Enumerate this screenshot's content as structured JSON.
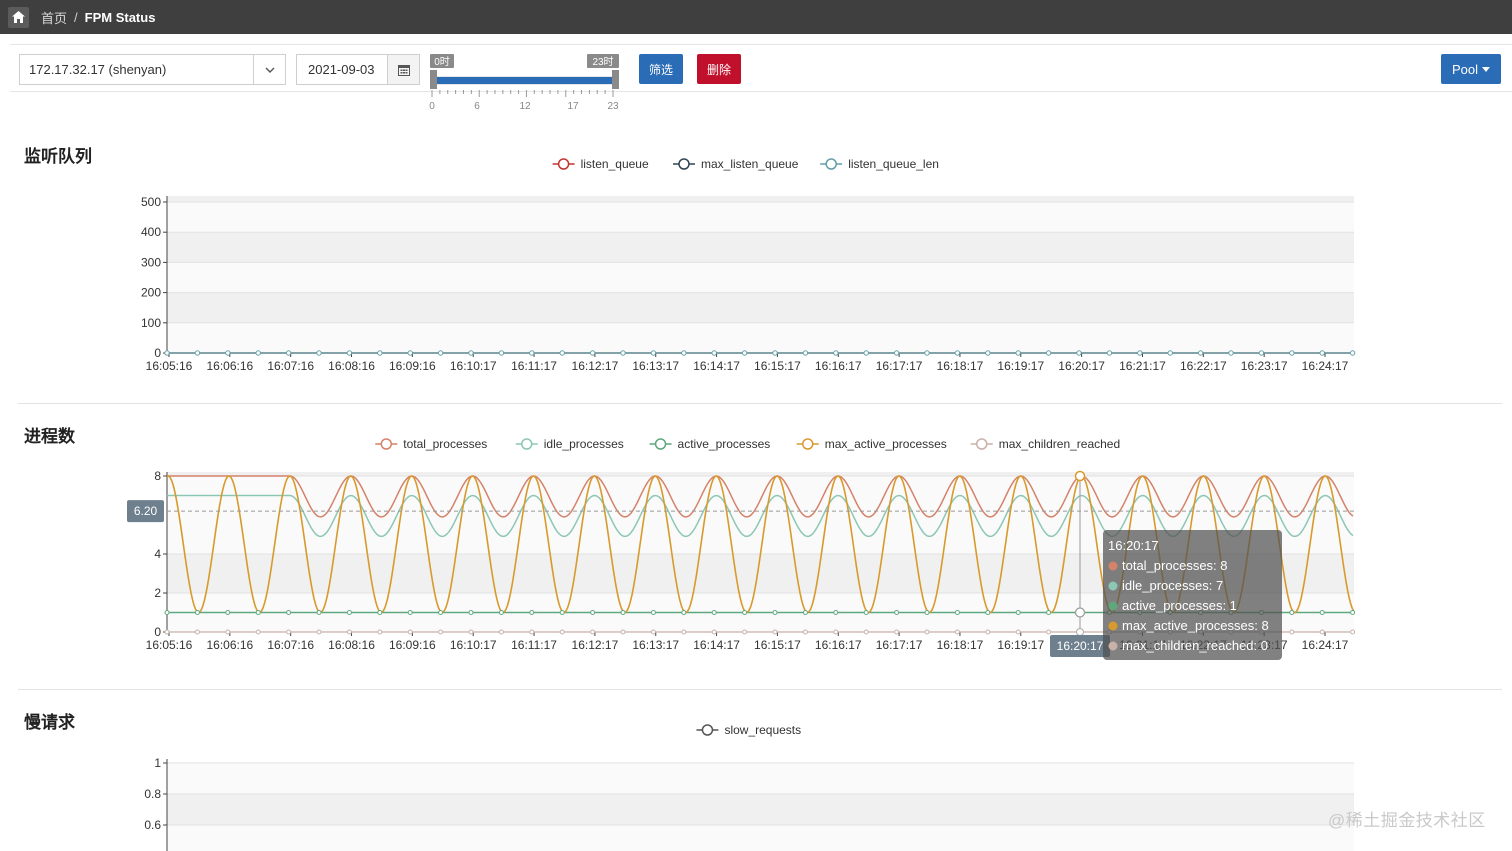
{
  "breadcrumb": {
    "home": "首页",
    "separator": "/",
    "current": "FPM Status"
  },
  "toolbar": {
    "server": "172.17.32.17 (shenyan)",
    "date": "2021-09-03",
    "range_start_label": "0时",
    "range_end_label": "23时",
    "range_ticks": [
      "0",
      "6",
      "12",
      "17",
      "23"
    ],
    "filter_label": "筛选",
    "delete_label": "删除",
    "pool_label": "Pool"
  },
  "sections": {
    "listen": "监听队列",
    "processes": "进程数",
    "slow": "慢请求"
  },
  "watermark": "@稀土掘金技术社区",
  "chart_data": [
    {
      "type": "line",
      "title": "监听队列",
      "x": [
        "16:05:16",
        "16:06:16",
        "16:07:16",
        "16:08:16",
        "16:09:16",
        "16:10:17",
        "16:11:17",
        "16:12:17",
        "16:13:17",
        "16:14:17",
        "16:15:17",
        "16:16:17",
        "16:17:17",
        "16:18:17",
        "16:19:17",
        "16:20:17",
        "16:21:17",
        "16:22:17",
        "16:23:17",
        "16:24:17"
      ],
      "ylim": [
        0,
        500
      ],
      "yticks": [
        "0",
        "100",
        "200",
        "300",
        "400",
        "500"
      ],
      "series": [
        {
          "name": "listen_queue",
          "color": "#c23531",
          "values": [
            0,
            0,
            0,
            0,
            0,
            0,
            0,
            0,
            0,
            0,
            0,
            0,
            0,
            0,
            0,
            0,
            0,
            0,
            0,
            0
          ]
        },
        {
          "name": "max_listen_queue",
          "color": "#2f4554",
          "values": [
            0,
            0,
            0,
            0,
            0,
            0,
            0,
            0,
            0,
            0,
            0,
            0,
            0,
            0,
            0,
            0,
            0,
            0,
            0,
            0
          ]
        },
        {
          "name": "listen_queue_len",
          "color": "#61a0a8",
          "values": [
            0,
            0,
            0,
            0,
            0,
            0,
            0,
            0,
            0,
            0,
            0,
            0,
            0,
            0,
            0,
            0,
            0,
            0,
            0,
            0
          ]
        }
      ]
    },
    {
      "type": "line",
      "title": "进程数",
      "x": [
        "16:05:16",
        "16:06:16",
        "16:07:16",
        "16:08:16",
        "16:09:16",
        "16:10:17",
        "16:11:17",
        "16:12:17",
        "16:13:17",
        "16:14:17",
        "16:15:17",
        "16:16:17",
        "16:17:17",
        "16:18:17",
        "16:19:17",
        "16:20:17",
        "16:21:17",
        "16:22:17",
        "16:23:17",
        "16:24:17"
      ],
      "ylim": [
        0,
        8
      ],
      "yticks": [
        "0",
        "2",
        "4",
        "8"
      ],
      "cursor_y_label": "6.20",
      "series": [
        {
          "name": "total_processes",
          "color": "#d4826a",
          "values": [
            8,
            8,
            8,
            8,
            8,
            8,
            8,
            8,
            8,
            8,
            8,
            8,
            8,
            8,
            8,
            8,
            8,
            8,
            8,
            8
          ]
        },
        {
          "name": "idle_processes",
          "color": "#8cc7b5",
          "values": [
            7,
            7,
            7,
            7,
            7,
            7,
            7,
            7,
            7,
            7,
            7,
            7,
            7,
            7,
            7,
            7,
            7,
            7,
            7,
            7
          ]
        },
        {
          "name": "active_processes",
          "color": "#5fa77e",
          "values": [
            1,
            1,
            1,
            1,
            1,
            1,
            1,
            1,
            1,
            1,
            1,
            1,
            1,
            1,
            1,
            1,
            1,
            1,
            1,
            1
          ]
        },
        {
          "name": "max_active_processes",
          "color": "#d89a2c",
          "values": [
            8,
            8,
            8,
            8,
            8,
            8,
            8,
            8,
            8,
            8,
            8,
            8,
            8,
            8,
            8,
            8,
            8,
            8,
            8,
            8
          ]
        },
        {
          "name": "max_children_reached",
          "color": "#c9b0a8",
          "values": [
            0,
            0,
            0,
            0,
            0,
            0,
            0,
            0,
            0,
            0,
            0,
            0,
            0,
            0,
            0,
            0,
            0,
            0,
            0,
            0
          ]
        }
      ],
      "tooltip": {
        "title": "16:20:17",
        "rows": [
          {
            "label": "total_processes: 8",
            "color": "#d4826a"
          },
          {
            "label": "idle_processes: 7",
            "color": "#8cc7b5"
          },
          {
            "label": "active_processes: 1",
            "color": "#5fa77e"
          },
          {
            "label": "max_active_processes: 8",
            "color": "#d89a2c"
          },
          {
            "label": "max_children_reached: 0",
            "color": "#c9b0a8"
          }
        ],
        "x_label": "16:20:17"
      }
    },
    {
      "type": "line",
      "title": "慢请求",
      "ylim": [
        0,
        1
      ],
      "yticks": [
        "0.6",
        "0.8",
        "1"
      ],
      "series": [
        {
          "name": "slow_requests",
          "color": "#555555",
          "values": []
        }
      ]
    }
  ]
}
